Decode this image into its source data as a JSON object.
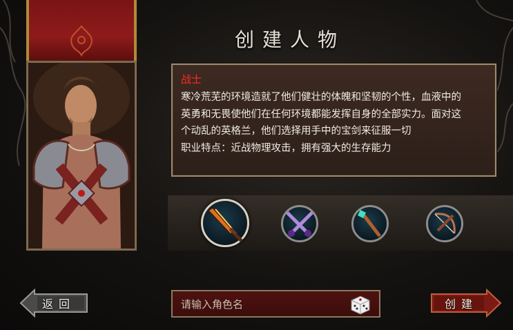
{
  "screen": {
    "title": "创建人物"
  },
  "character": {
    "name": "战士",
    "description_lines": [
      "寒冷荒芜的环境造就了他们健壮的体魄和坚韧的个性，血液中的",
      "英勇和无畏使他们在任何环境都能发挥自身的全部实力。面对这",
      "个动乱的英格兰，他们选择用手中的宝剑来征服一切",
      "职业特点：近战物理攻击，拥有强大的生存能力"
    ]
  },
  "classes": [
    {
      "icon": "flame-sword-icon",
      "selected": true
    },
    {
      "icon": "crossed-daggers-icon",
      "selected": false
    },
    {
      "icon": "crystal-staff-icon",
      "selected": false
    },
    {
      "icon": "crossbow-icon",
      "selected": false
    }
  ],
  "buttons": {
    "back": "返回",
    "create": "创建"
  },
  "name_field": {
    "placeholder": "请输入角色名",
    "value": ""
  },
  "colors": {
    "accent_red": "#ff2a20",
    "panel_border": "#a08a6a",
    "button_gray": "#4a4a4a",
    "button_red": "#7a1a12"
  }
}
